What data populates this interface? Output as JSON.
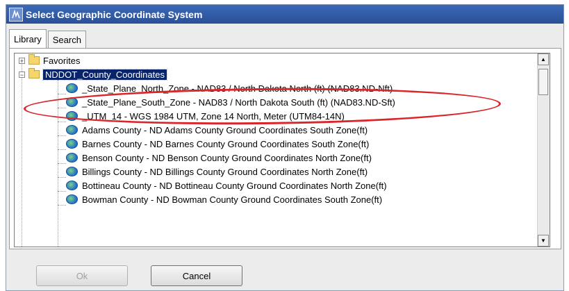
{
  "window": {
    "title": "Select Geographic Coordinate System"
  },
  "tabs": [
    {
      "label": "Library",
      "active": true
    },
    {
      "label": "Search",
      "active": false
    }
  ],
  "tree": {
    "rows": [
      {
        "label": "Favorites",
        "type": "folder",
        "expander": "+"
      },
      {
        "label": "NDDOT_County_Coordinates",
        "type": "folder",
        "expander": "−",
        "selected": true
      },
      {
        "label": "_State_Plane_North_Zone - NAD83 / North Dakota North (ft) (NAD83.ND-Nft)",
        "type": "item"
      },
      {
        "label": "_State_Plane_South_Zone - NAD83 / North Dakota South (ft) (NAD83.ND-Sft)",
        "type": "item"
      },
      {
        "label": "_UTM_14 - WGS 1984 UTM, Zone 14 North, Meter (UTM84-14N)",
        "type": "item"
      },
      {
        "label": "Adams County - ND Adams County Ground Coordinates South Zone(ft)",
        "type": "item"
      },
      {
        "label": "Barnes County - ND Barnes County Ground Coordinates South Zone(ft)",
        "type": "item"
      },
      {
        "label": "Benson County - ND Benson County Ground Coordinates North Zone(ft)",
        "type": "item"
      },
      {
        "label": "Billings County - ND Billings County Ground Coordinates North Zone(ft)",
        "type": "item"
      },
      {
        "label": "Bottineau County - ND Bottineau County Ground Coordinates North Zone(ft)",
        "type": "item"
      },
      {
        "label": "Bowman County - ND Bowman County Ground Coordinates South Zone(ft)",
        "type": "item"
      }
    ]
  },
  "buttons": {
    "ok_label": "Ok",
    "cancel_label": "Cancel"
  },
  "icons": {
    "folder": "folder-icon",
    "globe": "globe-icon",
    "app": "app-icon"
  },
  "colors": {
    "titlebar": "#2a5098",
    "selection": "#0a246a",
    "annotation": "#d9262a"
  }
}
